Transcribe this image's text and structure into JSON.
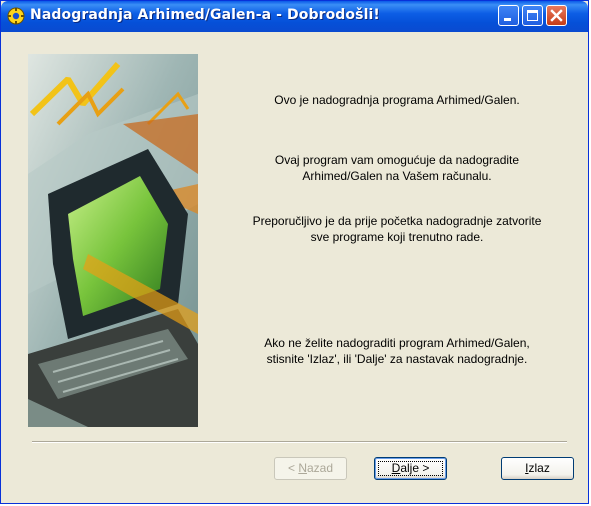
{
  "window": {
    "title": "Nadogradnja Arhimed/Galen-a - Dobrodošli!"
  },
  "messages": {
    "intro": "Ovo je nadogradnja programa Arhimed/Galen.",
    "purpose_line1": "Ovaj program vam omogućuje da nadogradite",
    "purpose_line2": "Arhimed/Galen na Vašem računalu.",
    "advice_line1": "Preporučljivo je da prije početka nadogradnje zatvorite",
    "advice_line2": "sve programe koji trenutno rade.",
    "exit_line1": "Ako ne želite nadograditi program Arhimed/Galen,",
    "exit_line2": "stisnite 'Izlaz', ili 'Dalje' za nastavak nadogradnje."
  },
  "buttons": {
    "back": {
      "label_prefix": "< ",
      "mnemonic": "N",
      "label_rest": "azad"
    },
    "next": {
      "mnemonic": "D",
      "label_rest": "alje >"
    },
    "exit": {
      "mnemonic": "I",
      "label_rest": "zlaz"
    }
  },
  "colors": {
    "titlebar": "#0a5ae8",
    "window_bg": "#ece9d8",
    "close_button": "#c53c17"
  },
  "icons": [
    "setup-gear-icon",
    "minimize-icon",
    "maximize-icon",
    "close-icon"
  ]
}
